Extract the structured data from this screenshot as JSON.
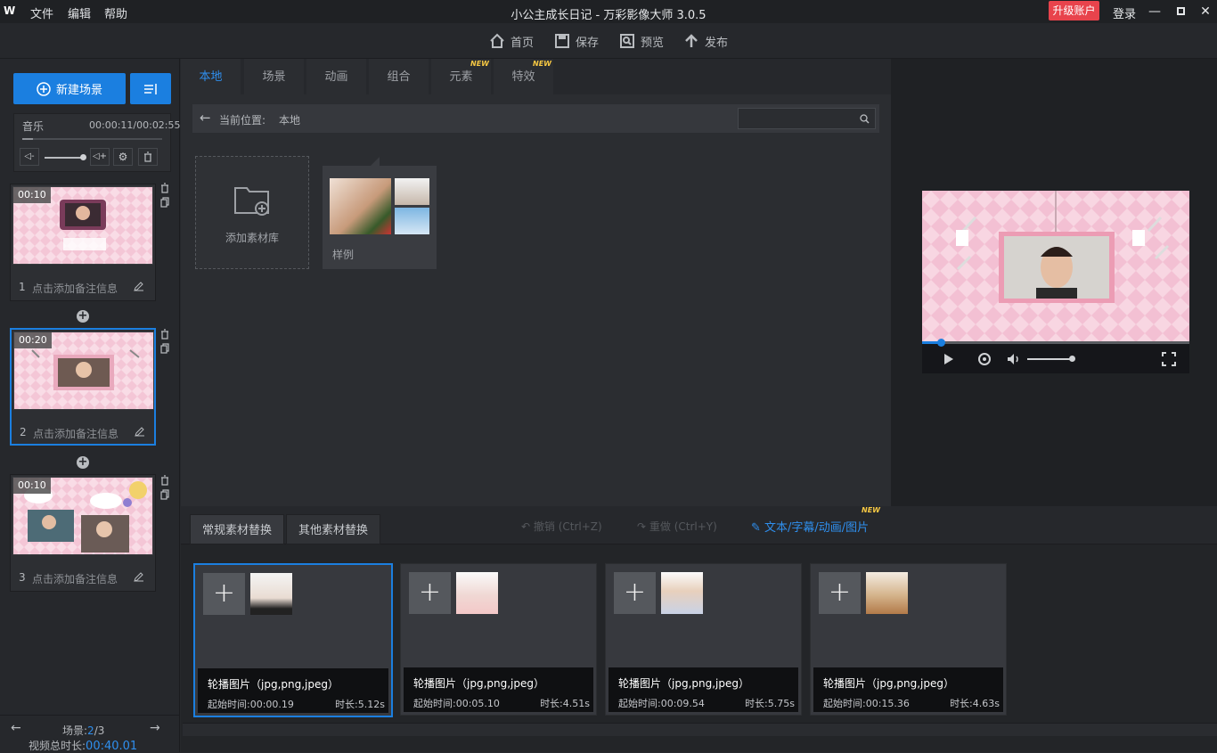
{
  "titlebar": {
    "logo": "W",
    "menus": [
      "文件",
      "编辑",
      "帮助"
    ],
    "title": "小公主成长日记 - 万彩影像大师 3.0.5",
    "upgrade": "升级账户",
    "login": "登录"
  },
  "toolbar": {
    "home": "首页",
    "save": "保存",
    "preview": "预览",
    "publish": "发布"
  },
  "left": {
    "new_scene": "新建场景",
    "music_label": "音乐",
    "music_time": "00:00:11/00:02:55",
    "scenes": [
      {
        "duration": "00:10",
        "num": "1",
        "note": "点击添加备注信息"
      },
      {
        "duration": "00:20",
        "num": "2",
        "note": "点击添加备注信息"
      },
      {
        "duration": "00:10",
        "num": "3",
        "note": "点击添加备注信息"
      }
    ],
    "nav": {
      "label": "场景:",
      "current": "2",
      "total": "/3",
      "total_label": "视频总时长:",
      "total_time": "00:40.01"
    }
  },
  "center": {
    "tabs": [
      "本地",
      "场景",
      "动画",
      "组合",
      "元素",
      "特效"
    ],
    "new_badge": "NEW",
    "path_label": "当前位置:",
    "path_value": "本地",
    "add_library": "添加素材库",
    "folder_label": "样例"
  },
  "bottom": {
    "tabs": [
      "常规素材替换",
      "其他素材替换"
    ],
    "undo": "撤销 (Ctrl+Z)",
    "redo": "重做 (Ctrl+Y)",
    "text_link": "文本/字幕/动画/图片",
    "cards": [
      {
        "title": "轮播图片（jpg,png,jpeg）",
        "start": "起始时间:00:00.19",
        "dur": "时长:5.12s"
      },
      {
        "title": "轮播图片（jpg,png,jpeg）",
        "start": "起始时间:00:05.10",
        "dur": "时长:4.51s"
      },
      {
        "title": "轮播图片（jpg,png,jpeg）",
        "start": "起始时间:00:09.54",
        "dur": "时长:5.75s"
      },
      {
        "title": "轮播图片（jpg,png,jpeg）",
        "start": "起始时间:00:15.36",
        "dur": "时长:4.63s"
      }
    ]
  },
  "colors": {
    "accent": "#1b7fe0",
    "upgrade": "#e8434c",
    "pink": "#f4c6d6"
  }
}
